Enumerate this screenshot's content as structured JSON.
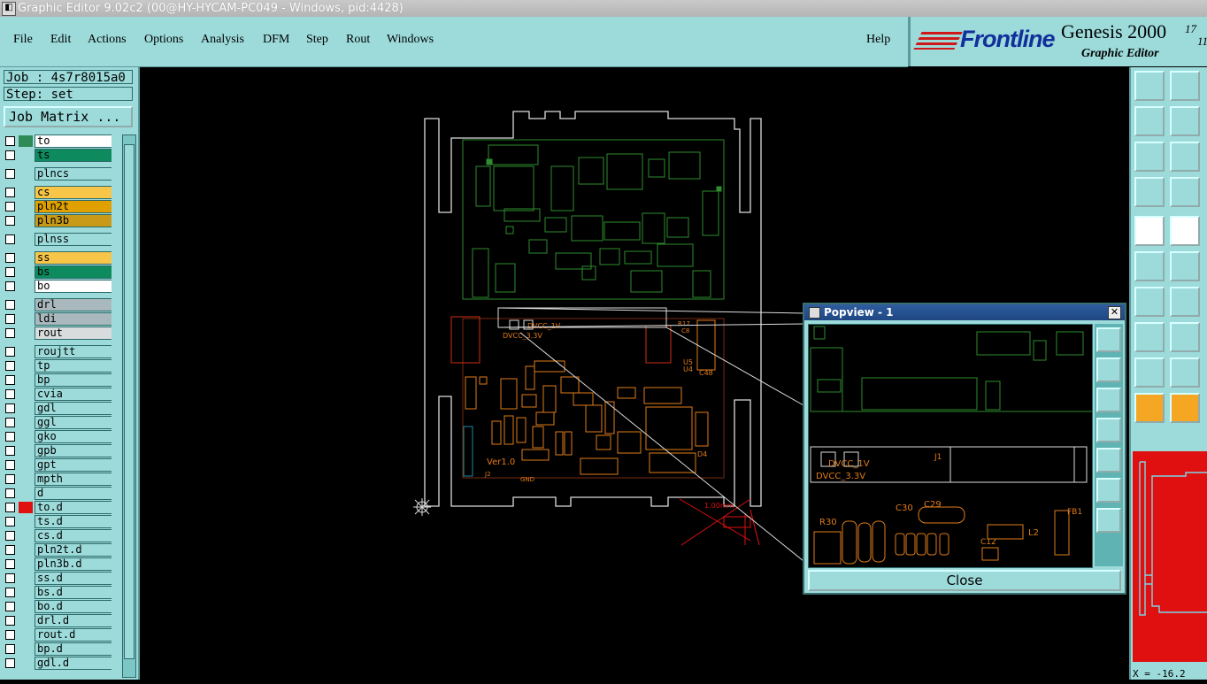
{
  "window": {
    "title": "Graphic Editor 9.02c2 (00@HY-HYCAM-PC049 - Windows, pid:4428)"
  },
  "menu": {
    "items": [
      {
        "label": "File"
      },
      {
        "label": "Edit"
      },
      {
        "label": "Actions"
      },
      {
        "label": "Options"
      },
      {
        "label": "Analysis"
      },
      {
        "label": "DFM"
      },
      {
        "label": "Step"
      },
      {
        "label": "Rout"
      },
      {
        "label": "Windows"
      }
    ],
    "help": "Help"
  },
  "brand": {
    "logo": "Frontline",
    "product": "Genesis 2000",
    "version_a": "17",
    "version_b": "11",
    "subtitle": "Graphic Editor"
  },
  "job": {
    "job_label": "Job : 4s7r8015a0",
    "step_label": "Step: set",
    "matrix_button": "Job Matrix ..."
  },
  "layers": [
    {
      "name": "to",
      "color": "#ffffff",
      "swatch": "#2e8b57"
    },
    {
      "name": "ts",
      "color": "#0d8a5e"
    },
    {
      "name": "plncs",
      "color": "#9ddbdb"
    },
    {
      "name": "cs",
      "color": "#f7c548"
    },
    {
      "name": "pln2t",
      "color": "#e0a100"
    },
    {
      "name": "pln3b",
      "color": "#c99a18"
    },
    {
      "name": "plnss",
      "color": "#9ddbdb"
    },
    {
      "name": "ss",
      "color": "#f7c548"
    },
    {
      "name": "bs",
      "color": "#0d8a5e"
    },
    {
      "name": "bo",
      "color": "#ffffff"
    },
    {
      "name": "drl",
      "color": "#a9b8bc"
    },
    {
      "name": "ldi",
      "color": "#a9b8bc"
    },
    {
      "name": "rout",
      "color": "#d8dcdc"
    },
    {
      "name": "roujtt",
      "color": "#9ddbdb"
    },
    {
      "name": "tp",
      "color": "#9ddbdb"
    },
    {
      "name": "bp",
      "color": "#9ddbdb"
    },
    {
      "name": "cvia",
      "color": "#9ddbdb"
    },
    {
      "name": "gdl",
      "color": "#9ddbdb"
    },
    {
      "name": "ggl",
      "color": "#9ddbdb"
    },
    {
      "name": "gko",
      "color": "#9ddbdb"
    },
    {
      "name": "gpb",
      "color": "#9ddbdb"
    },
    {
      "name": "gpt",
      "color": "#9ddbdb"
    },
    {
      "name": "mpth",
      "color": "#9ddbdb"
    },
    {
      "name": "d",
      "color": "#9ddbdb"
    },
    {
      "name": "to.d",
      "color": "#9ddbdb",
      "swatch": "#e01010"
    },
    {
      "name": "ts.d",
      "color": "#9ddbdb"
    },
    {
      "name": "cs.d",
      "color": "#9ddbdb"
    },
    {
      "name": "pln2t.d",
      "color": "#9ddbdb"
    },
    {
      "name": "pln3b.d",
      "color": "#9ddbdb"
    },
    {
      "name": "ss.d",
      "color": "#9ddbdb"
    },
    {
      "name": "bs.d",
      "color": "#9ddbdb"
    },
    {
      "name": "bo.d",
      "color": "#9ddbdb"
    },
    {
      "name": "drl.d",
      "color": "#9ddbdb"
    },
    {
      "name": "rout.d",
      "color": "#9ddbdb"
    },
    {
      "name": "bp.d",
      "color": "#9ddbdb"
    },
    {
      "name": "gdl.d",
      "color": "#9ddbdb"
    }
  ],
  "popview": {
    "title": "Popview - 1",
    "close": "Close"
  },
  "board_labels": {
    "dvcc1v": "DVCC_1V",
    "dvcc33": "DVCC_3.3V",
    "ver": "Ver1.0",
    "dim": "1.00mm",
    "j1": "J1",
    "l2": "L2",
    "fb1": "FB1",
    "c29": "C29",
    "r30": "R30",
    "c30": "C30",
    "c12": "C12",
    "u5": "U5",
    "u4": "U4",
    "c48": "C48",
    "d4": "D4",
    "j2": "J2",
    "gnd": "GND",
    "r17": "R17",
    "c8": "C8"
  },
  "coord": "X = -16.2",
  "colors": {
    "panel": "#9ddbdb",
    "accent_red": "#e01010",
    "green_layer": "#2e8b2e",
    "orange_layer": "#e07b1a"
  }
}
